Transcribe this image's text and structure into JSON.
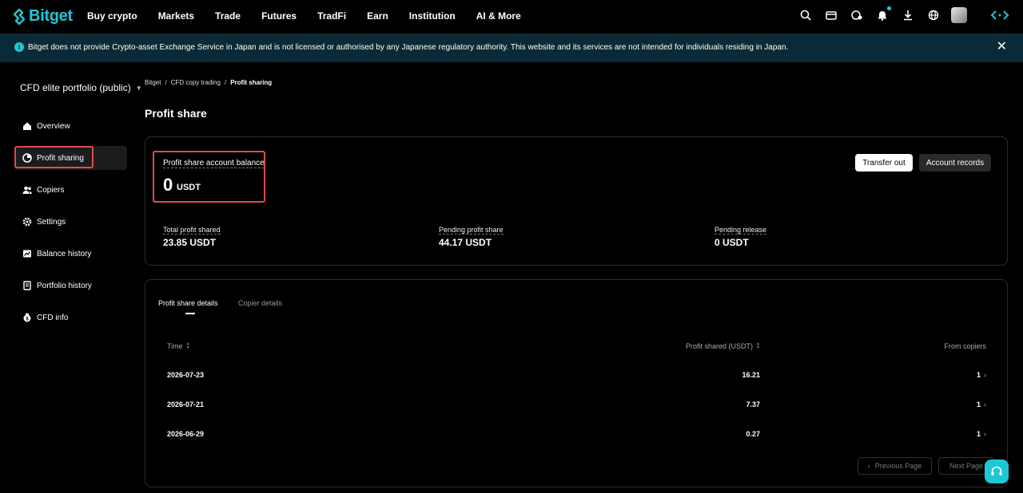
{
  "brand": {
    "name": "Bitget",
    "accent": "#1fc7d4"
  },
  "nav": {
    "items": [
      "Buy crypto",
      "Markets",
      "Trade",
      "Futures",
      "TradFi",
      "Earn",
      "Institution",
      "AI & More"
    ],
    "icons": [
      "search-icon",
      "wallet-icon",
      "assets-icon",
      "bell-icon",
      "download-icon",
      "globe-icon",
      "avatar",
      "switch-icon"
    ]
  },
  "banner": {
    "text": "Bitget does not provide Crypto-asset Exchange Service in Japan and is not licensed or authorised by any Japanese regulatory authority. This website and its services are not intended for individuals residing in Japan.",
    "close": "✕"
  },
  "sidebar": {
    "title": "CFD elite portfolio (public)",
    "items": [
      {
        "label": "Overview",
        "icon": "home-icon"
      },
      {
        "label": "Profit sharing",
        "icon": "pie-chart-icon",
        "active": true
      },
      {
        "label": "Copiers",
        "icon": "users-icon"
      },
      {
        "label": "Settings",
        "icon": "gear-icon"
      },
      {
        "label": "Balance history",
        "icon": "chart-icon"
      },
      {
        "label": "Portfolio history",
        "icon": "portfolio-icon"
      },
      {
        "label": "CFD info",
        "icon": "info-icon"
      }
    ]
  },
  "breadcrumb": [
    "Bitget",
    "/",
    "CFD copy trading",
    "/",
    "Profit sharing"
  ],
  "page": {
    "title": "Profit share"
  },
  "balance": {
    "label": "Profit share account balance",
    "value": "0",
    "unit": "USDT",
    "transfer_out": "Transfer out",
    "account_records": "Account records"
  },
  "stats": [
    {
      "label": "Total profit shared",
      "value": "23.85 USDT"
    },
    {
      "label": "Pending profit share",
      "value": "44.17 USDT"
    },
    {
      "label": "Pending release",
      "value": "0 USDT"
    }
  ],
  "tabs": [
    "Profit share details",
    "Copier details"
  ],
  "table": {
    "headers": [
      "Time",
      "Profit shared (USDT)",
      "From copiers"
    ],
    "rows": [
      {
        "time": "2026-07-23",
        "profit": "16.21",
        "copiers": "1"
      },
      {
        "time": "2026-07-21",
        "profit": "7.37",
        "copiers": "1"
      },
      {
        "time": "2026-06-29",
        "profit": "0.27",
        "copiers": "1"
      }
    ]
  },
  "pagination": {
    "prev": "Previous Page",
    "next": "Next Page"
  }
}
